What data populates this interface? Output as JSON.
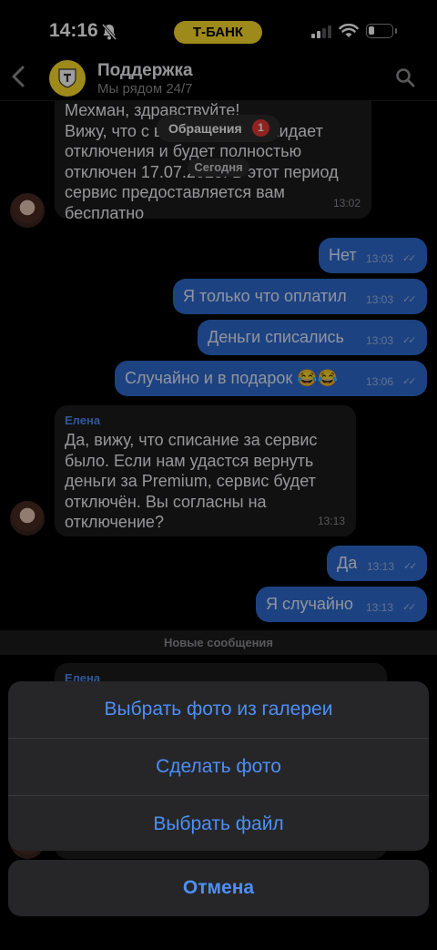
{
  "status_bar": {
    "time": "14:16",
    "bank_label": "Т-БАНК"
  },
  "header": {
    "title": "Поддержка",
    "subtitle": "Мы рядом 24/7"
  },
  "top_overlay": {
    "tab_label": "Обращения",
    "tab_badge": "1",
    "date_label": "Сегодня"
  },
  "messages": [
    {
      "line1": "Мехман, здравствуйте!",
      "line2": "Вижу, что с ваш Premium ожидает",
      "line3": "отключения и будет полностью",
      "line4": "отключен 17.07.2025. В этот период",
      "line5": "сервис предоставляется вам",
      "line6": "бесплатно",
      "time": "13:02"
    },
    {
      "text": "Нет",
      "time": "13:03",
      "checks": "✓✓"
    },
    {
      "text": "Я только что оплатил",
      "time": "13:03",
      "checks": "✓✓"
    },
    {
      "text": "Деньги списались",
      "time": "13:03",
      "checks": "✓✓"
    },
    {
      "text": "Случайно и в подарок 😂😂",
      "time": "13:06",
      "checks": "✓✓"
    },
    {
      "sender": "Елена",
      "line1": "Да, вижу, что списание за сервис",
      "line2": "было. Если нам удастся вернуть",
      "line3": "деньги за Premium, сервис будет",
      "line4": "отключён. Вы согласны на",
      "line5": "отключение?",
      "time": "13:13"
    },
    {
      "text": "Да",
      "time": "13:13",
      "checks": "✓✓"
    },
    {
      "text": "Я случайно",
      "time": "13:13",
      "checks": "✓✓"
    },
    {
      "sender": "Елена"
    }
  ],
  "new_messages_label": "Новые сообщения",
  "action_sheet": {
    "gallery": "Выбрать фото из галереи",
    "camera": "Сделать фото",
    "file": "Выбрать файл",
    "cancel": "Отмена"
  },
  "colors": {
    "accent": "#4d8ff7",
    "bank_yellow": "#ffdd2d",
    "outgoing_bubble": "#2f6bd1",
    "incoming_bubble": "#1c1c1e"
  }
}
